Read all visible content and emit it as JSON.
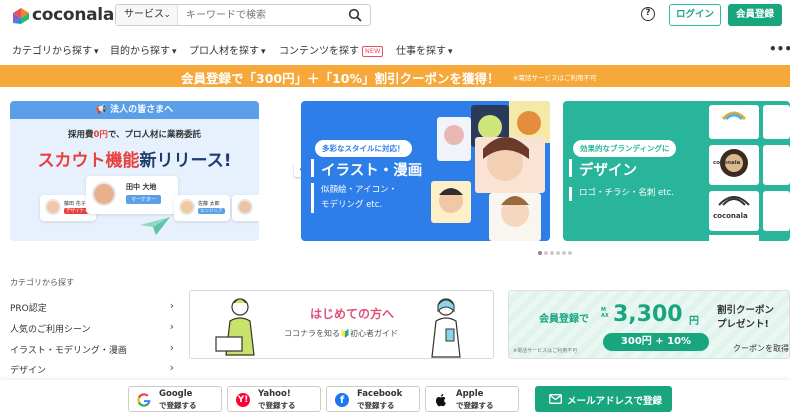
{
  "header": {
    "logo_text": "coconala",
    "search_category": "サービス",
    "search_placeholder": "キーワードで検索",
    "login_label": "ログイン",
    "register_label": "会員登録"
  },
  "nav": {
    "items": [
      {
        "label": "カテゴリから探す"
      },
      {
        "label": "目的から探す"
      },
      {
        "label": "プロ人材を探す"
      },
      {
        "label": "コンテンツを探す",
        "badge": "NEW"
      },
      {
        "label": "仕事を探す"
      }
    ]
  },
  "promo": {
    "text": "会員登録で「300円」＋「10%」割引クーポンを獲得！",
    "note": "※電話サービスはご利用不可"
  },
  "carousel": {
    "card1": {
      "tab": "法人の皆さまへ",
      "sub_prefix": "採用費",
      "sub_red": "0円",
      "sub_suffix": "で、プロ人材に業務委託",
      "title_red": "スカウト機能",
      "title_rest": "新リリース!",
      "people": [
        {
          "name": "田中 大地",
          "tag": "マーケター"
        },
        {
          "name": "藤田 花子",
          "tag": "デザイナー"
        },
        {
          "name": "佐藤 太郎",
          "tag": "エンジニア"
        }
      ]
    },
    "card2": {
      "bubble": "多彩なスタイルに対応！",
      "title": "イラスト・漫画",
      "desc1": "似顔絵・アイコン・",
      "desc2": "モデリング etc."
    },
    "card3": {
      "bubble": "効果的なブランディングに",
      "title": "デザイン",
      "desc1": "ロゴ・チラシ・名刺 etc.",
      "logo_text": "coconala"
    },
    "active_index": 0,
    "dot_count": 6
  },
  "categories": {
    "title": "カテゴリから探す",
    "items": [
      {
        "label": "PRO認定"
      },
      {
        "label": "人気のご利用シーン"
      },
      {
        "label": "イラスト・モデリング・漫画"
      },
      {
        "label": "デザイン"
      }
    ]
  },
  "beginner": {
    "title": "はじめての方へ",
    "sub": "ココナラを知る🔰初心者ガイド"
  },
  "coupon": {
    "signup": "会員登録で",
    "max": "MAX",
    "amount": "3,300",
    "yen": "円",
    "title1": "割引クーポン",
    "title2": "プレゼント!",
    "detail": "300円 + 10%",
    "note": "※電話サービスはご利用不可",
    "cta": "クーポンを取得"
  },
  "social": {
    "buttons": [
      {
        "name": "Google",
        "sub": "で登録する"
      },
      {
        "name": "Yahoo!",
        "sub": "で登録する"
      },
      {
        "name": "Facebook",
        "sub": "で登録する"
      },
      {
        "name": "Apple",
        "sub": "で登録する"
      }
    ],
    "mail": "メールアドレスで登録"
  },
  "colors": {
    "brand_green": "#19a67f",
    "promo_orange": "#f7a83a",
    "illust_blue": "#2d7ee8",
    "design_teal": "#29b49c"
  }
}
